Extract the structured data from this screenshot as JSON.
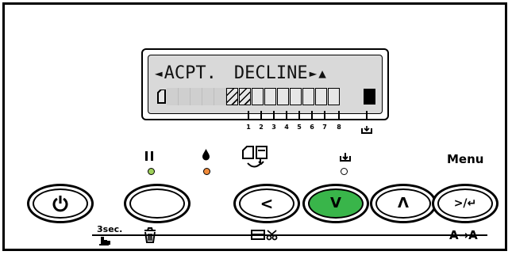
{
  "lcd": {
    "line1_left_arrow": "◄",
    "line1_option1": "ACPT.",
    "line1_option2": "DECLINE",
    "line1_right_arrow": "►",
    "line1_up_arrow": "▲",
    "slot_count": 9,
    "slots_used": 2
  },
  "indicators": {
    "tick_labels": [
      "1",
      "2",
      "3",
      "4",
      "5",
      "6",
      "7",
      "8"
    ]
  },
  "labels": {
    "menu": "Menu",
    "three_sec": "3sec.",
    "paper_source_feed_label": "A→A"
  },
  "colors": {
    "pause_led": "#9ed05a",
    "ink_led": "#f08a3a",
    "ok_button": "#39b54a",
    "lcd_bg": "#d9d9d9"
  },
  "icons": {
    "power": "power-icon",
    "pause": "pause-icon",
    "ink": "ink-drop-icon",
    "paper_feed": "paper-feed-icon",
    "menu": "menu-icon",
    "trash": "trash-icon",
    "hand_3sec": "hand-press-icon",
    "cut": "cut-icon"
  }
}
